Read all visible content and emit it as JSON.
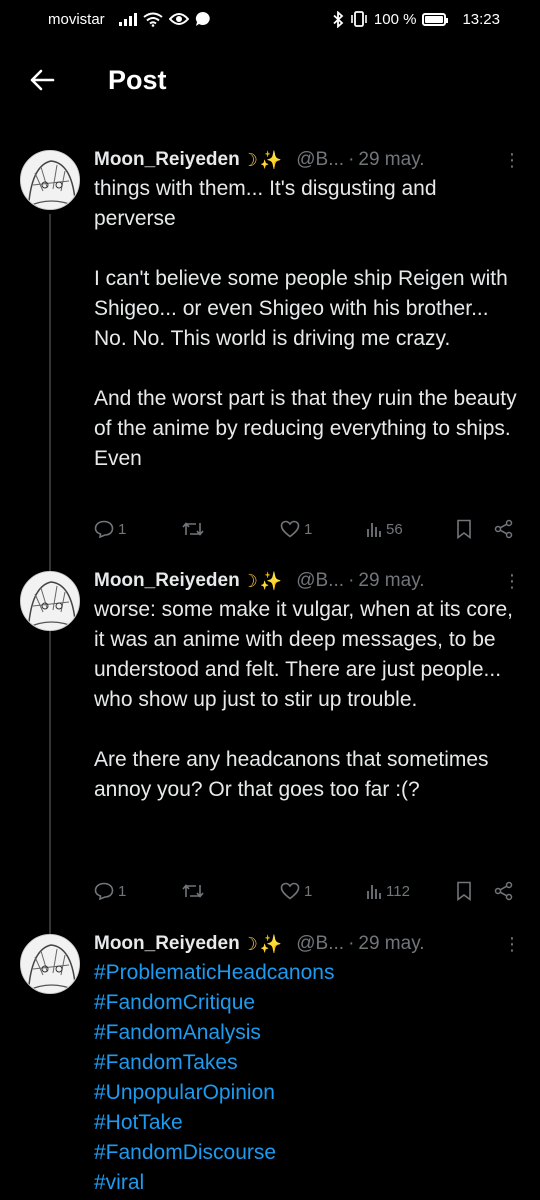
{
  "status_bar": {
    "carrier": "movistar",
    "battery_percent": "100 %",
    "time": "13:23"
  },
  "header": {
    "title": "Post"
  },
  "posts": [
    {
      "author_name": "Moon_Reiyeden",
      "handle": "@B...",
      "date": "29 may.",
      "text": "things with them... It's disgusting and perverse\n\nI can't believe some people ship Reigen with Shigeo... or even Shigeo with his brother... No. No. This world is driving me crazy.\n\nAnd the worst part is that they ruin the beauty of the anime by reducing everything to ships. Even",
      "replies": "1",
      "reposts": "",
      "likes": "1",
      "views": "56"
    },
    {
      "author_name": "Moon_Reiyeden",
      "handle": "@B...",
      "date": "29 may.",
      "text": "worse: some make it vulgar, when at its core, it was an anime with deep messages, to be understood and felt. There are just people... who show up just to stir up trouble.\n\nAre there any headcanons that sometimes annoy you? Or that goes too far :(?",
      "replies": "1",
      "reposts": "",
      "likes": "1",
      "views": "112"
    },
    {
      "author_name": "Moon_Reiyeden",
      "handle": "@B...",
      "date": "29 may.",
      "hashtags": [
        "#ProblematicHeadcanons",
        "#FandomCritique",
        "#FandomAnalysis",
        "#FandomTakes",
        "#UnpopularOpinion",
        "#HotTake",
        "#FandomDiscourse",
        "#viral"
      ]
    }
  ],
  "icons": {
    "status": [
      "signal-icon",
      "wifi-icon",
      "eye-icon",
      "chat-icon",
      "bluetooth-icon",
      "vibrate-icon",
      "battery-icon"
    ],
    "post_actions": [
      "reply-icon",
      "repost-icon",
      "like-icon",
      "views-icon",
      "bookmark-icon",
      "share-icon"
    ]
  },
  "colors": {
    "background": "#000000",
    "text": "#e7e9ea",
    "secondary_text": "#71767b",
    "link": "#1d9bf0",
    "emoji_gold": "#f5c242"
  }
}
